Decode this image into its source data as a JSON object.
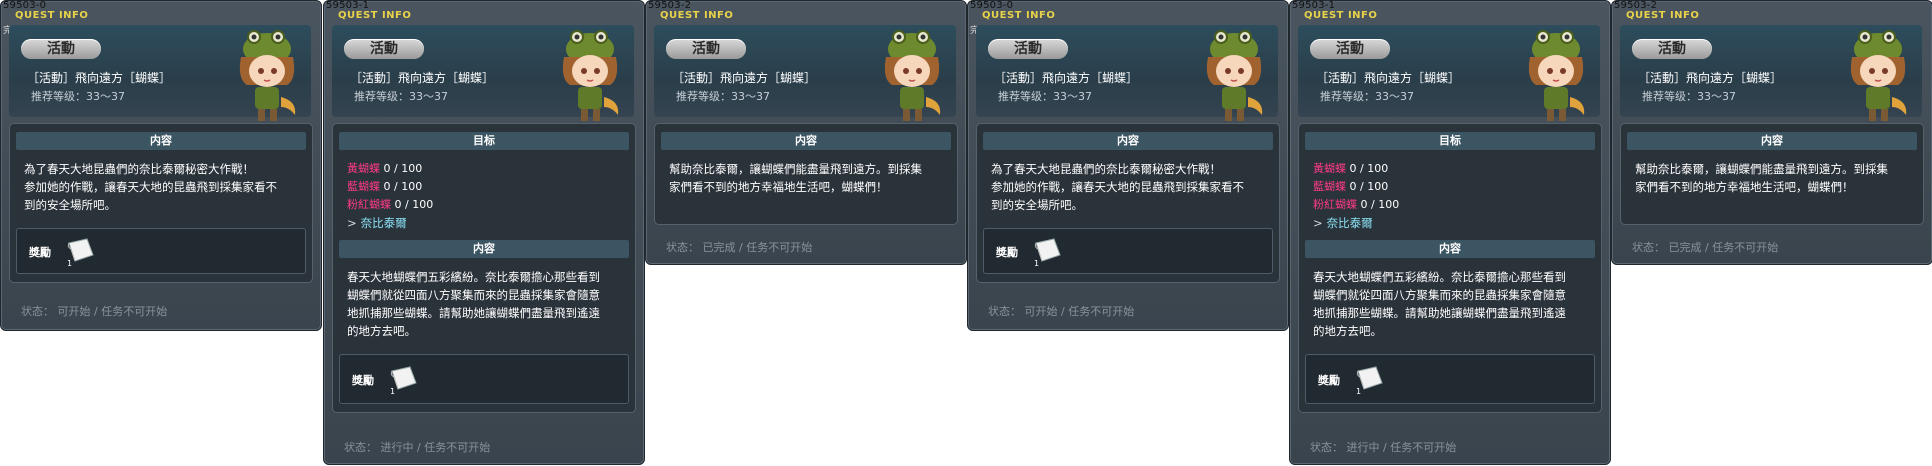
{
  "panels": [
    {
      "id": "59503-0",
      "title": "QUEST INFO",
      "note": "完了前",
      "badge": "活動",
      "name": "［活動］飛向遠方［蝴蝶］",
      "level": "推荐等级：33～37",
      "content_title": "内容",
      "content_lines": [
        "為了春天大地昆蟲們的奈比泰爾秘密大作戰！",
        "参加她的作戰，讓春天大地的昆蟲飛到採集家看不",
        "到的安全場所吧。"
      ],
      "reward_label": "獎勵",
      "reward_count": "1",
      "status": "状态：  可开始  /  任务不可开始"
    },
    {
      "id": "59503-1",
      "title": "QUEST INFO",
      "badge": "活動",
      "name": "［活動］飛向遠方［蝴蝶］",
      "level": "推荐等级：33～37",
      "target_title": "目标",
      "targets": [
        {
          "name": "黃蝴蝶",
          "progress": "0 / 100"
        },
        {
          "name": "藍蝴蝶",
          "progress": "0 / 100"
        },
        {
          "name": "粉紅蝴蝶",
          "progress": "0 / 100"
        }
      ],
      "npc": "奈比泰爾",
      "content_title": "内容",
      "content_lines": [
        "春天大地蝴蝶們五彩繽紛。奈比泰爾擔心那些看到",
        "蝴蝶們就從四面八方聚集而來的昆蟲採集家會隨意",
        "地抓捕那些蝴蝶。請幫助她讓蝴蝶們盡量飛到遙遠",
        "的地方去吧。"
      ],
      "reward_label": "獎勵",
      "reward_count": "1",
      "status": "状态：  进行中  /  任务不可开始"
    },
    {
      "id": "59503-2",
      "title": "QUEST INFO",
      "badge": "活動",
      "name": "［活動］飛向遠方［蝴蝶］",
      "level": "推荐等级：33～37",
      "content_title": "内容",
      "content_lines": [
        "幫助奈比泰爾，讓蝴蝶們能盡量飛到遠方。到採集",
        "家們看不到的地方幸福地生活吧，蝴蝶們！"
      ],
      "status": "状态：  已完成  /  任务不可开始"
    },
    {
      "id": "59503-0",
      "title": "QUEST INFO",
      "note": "完了前",
      "badge": "活動",
      "name": "［活動］飛向遠方［蝴蝶］",
      "level": "推荐等级：33～37",
      "content_title": "内容",
      "content_lines": [
        "為了春天大地昆蟲們的奈比泰爾秘密大作戰！",
        "参加她的作戰，讓春天大地的昆蟲飛到採集家看不",
        "到的安全場所吧。"
      ],
      "reward_label": "獎勵",
      "reward_count": "1",
      "status": "状态：  可开始  /  任务不可开始"
    },
    {
      "id": "59503-1",
      "title": "QUEST INFO",
      "badge": "活動",
      "name": "［活動］飛向遠方［蝴蝶］",
      "level": "推荐等级：33～37",
      "target_title": "目标",
      "targets": [
        {
          "name": "黃蝴蝶",
          "progress": "0 / 100"
        },
        {
          "name": "藍蝴蝶",
          "progress": "0 / 100"
        },
        {
          "name": "粉紅蝴蝶",
          "progress": "0 / 100"
        }
      ],
      "npc": "奈比泰爾",
      "content_title": "内容",
      "content_lines": [
        "春天大地蝴蝶們五彩繽紛。奈比泰爾擔心那些看到",
        "蝴蝶們就從四面八方聚集而來的昆蟲採集家會隨意",
        "地抓捕那些蝴蝶。請幫助她讓蝴蝶們盡量飛到遙遠",
        "的地方去吧。"
      ],
      "reward_label": "獎勵",
      "reward_count": "1",
      "status": "状态：  进行中  /  任务不可开始"
    },
    {
      "id": "59503-2",
      "title": "QUEST INFO",
      "badge": "活動",
      "name": "［活動］飛向遠方［蝴蝶］",
      "level": "推荐等级：33～37",
      "content_title": "内容",
      "content_lines": [
        "幫助奈比泰爾，讓蝴蝶們能盡量飛到遠方。到採集",
        "家們看不到的地方幸福地生活吧，蝴蝶們！"
      ],
      "status": "状态：  已完成  /  任务不可开始"
    }
  ],
  "icons": {
    "avatar": "npc-girl-frog-hat-icon",
    "reward": "scroll-reward-icon"
  }
}
